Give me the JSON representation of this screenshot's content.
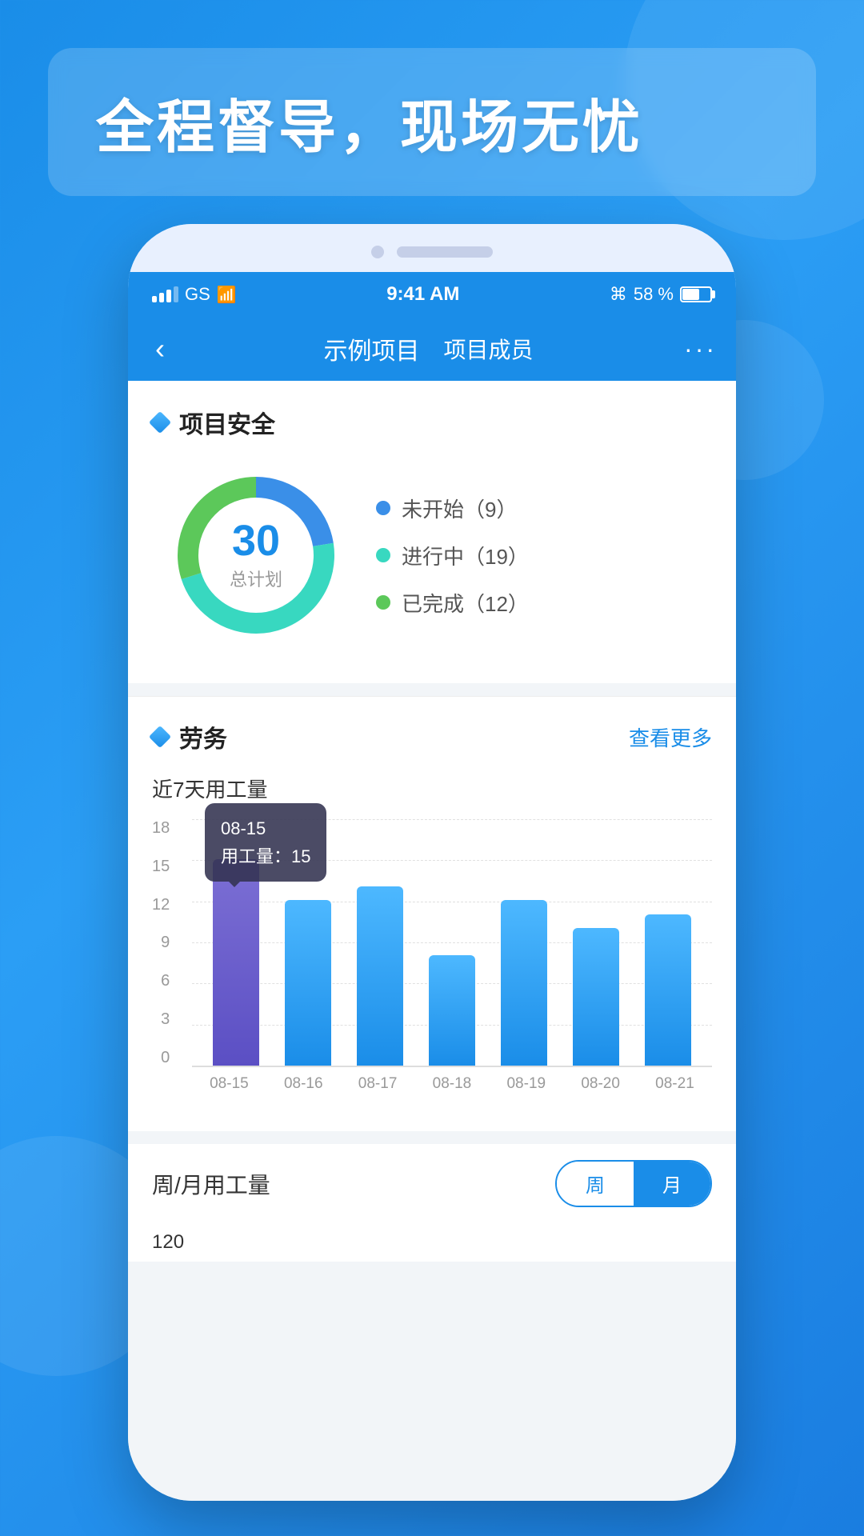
{
  "background": {
    "gradient_start": "#1a8de8",
    "gradient_end": "#1a7de0"
  },
  "banner": {
    "text": "全程督导，现场无忧"
  },
  "status_bar": {
    "carrier": "GS",
    "wifi": true,
    "time": "9:41 AM",
    "bluetooth": true,
    "battery_percent": "58 %"
  },
  "nav_bar": {
    "back_icon": "‹",
    "title": "示例项目",
    "subtitle": "项目成员",
    "more_icon": "···"
  },
  "project_safety": {
    "section_icon": "diamond",
    "section_title": "项目安全",
    "total": 30,
    "total_label": "总计划",
    "legend": [
      {
        "label": "未开始",
        "count": 9,
        "color": "#3a8fe8"
      },
      {
        "label": "进行中",
        "count": 19,
        "color": "#38d8c0"
      },
      {
        "label": "已完成",
        "count": 12,
        "color": "#5cc85a"
      }
    ],
    "donut_segments": [
      {
        "label": "未开始",
        "value": 9,
        "color": "#3a8fe8",
        "dash_offset": 0
      },
      {
        "label": "进行中",
        "value": 19,
        "color": "#38d8c0",
        "dash_offset": 0
      },
      {
        "label": "已完成",
        "value": 12,
        "color": "#5cc85a",
        "dash_offset": 0
      }
    ]
  },
  "labor": {
    "section_icon": "diamond",
    "section_title": "劳务",
    "more_label": "查看更多",
    "chart_subtitle": "近7天用工量",
    "y_axis_labels": [
      "18",
      "15",
      "12",
      "9",
      "6",
      "3",
      "0"
    ],
    "bars": [
      {
        "date": "08-15",
        "value": 15,
        "highlighted": true
      },
      {
        "date": "08-16",
        "value": 12,
        "highlighted": false
      },
      {
        "date": "08-17",
        "value": 13,
        "highlighted": false
      },
      {
        "date": "08-18",
        "value": 8,
        "highlighted": false
      },
      {
        "date": "08-19",
        "value": 12,
        "highlighted": false
      },
      {
        "date": "08-20",
        "value": 10,
        "highlighted": false
      },
      {
        "date": "08-21",
        "value": 11,
        "highlighted": false
      }
    ],
    "tooltip": {
      "date": "08-15",
      "label": "用工量：",
      "value": "15"
    },
    "max_value": 18
  },
  "week_month": {
    "label": "周/月用工量",
    "options": [
      {
        "text": "周",
        "active": false
      },
      {
        "text": "月",
        "active": true
      }
    ],
    "bottom_label": "120"
  }
}
